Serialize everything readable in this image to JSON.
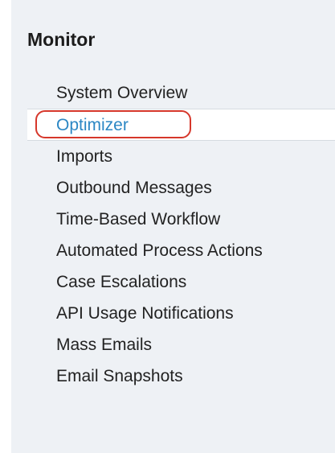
{
  "section": {
    "title": "Monitor"
  },
  "nav": {
    "items": [
      {
        "label": "System Overview"
      },
      {
        "label": "Optimizer",
        "selected": true
      },
      {
        "label": "Imports"
      },
      {
        "label": "Outbound Messages"
      },
      {
        "label": "Time-Based Workflow"
      },
      {
        "label": "Automated Process Actions"
      },
      {
        "label": "Case Escalations"
      },
      {
        "label": "API Usage Notifications"
      },
      {
        "label": "Mass Emails"
      },
      {
        "label": "Email Snapshots"
      }
    ]
  },
  "colors": {
    "panel_background": "#eef1f5",
    "selected_background": "#ffffff",
    "selected_text": "#2c87c4",
    "text": "#222222",
    "annotation_ring": "#d6372b"
  }
}
